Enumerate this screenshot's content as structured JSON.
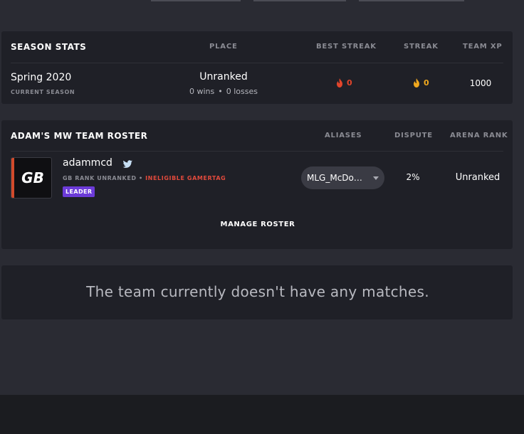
{
  "season": {
    "title": "SEASON STATS",
    "headers": {
      "place": "PLACE",
      "best_streak": "BEST STREAK",
      "streak": "STREAK",
      "team_xp": "TEAM XP"
    },
    "name": "Spring 2020",
    "subtitle": "CURRENT SEASON",
    "place": "Unranked",
    "wins": "0 wins",
    "losses": "0 losses",
    "best_streak": "0",
    "streak": "0",
    "team_xp": "1000",
    "colors": {
      "best_streak": "#e2452b",
      "streak": "#f0a81e"
    }
  },
  "roster": {
    "title": "ADAM'S MW TEAM ROSTER",
    "headers": {
      "aliases": "ALIASES",
      "dispute": "DISPUTE",
      "arena_rank": "ARENA RANK"
    },
    "player": {
      "avatar_text": "GB",
      "name": "adammcd",
      "platform_icon": "twitter-icon",
      "rank": "GB RANK UNRANKED",
      "warning": "INELIGIBLE GAMERTAG",
      "badge": "LEADER",
      "alias": "MLG_McDo…",
      "dispute": "2%",
      "arena_rank": "Unranked"
    },
    "manage_label": "MANAGE ROSTER",
    "colors": {
      "warning": "#e24a3c",
      "badge": "#6c3bd8",
      "avatar_stripe": "#d24a2b"
    }
  },
  "matches": {
    "empty_message": "The team currently doesn't have any matches."
  }
}
